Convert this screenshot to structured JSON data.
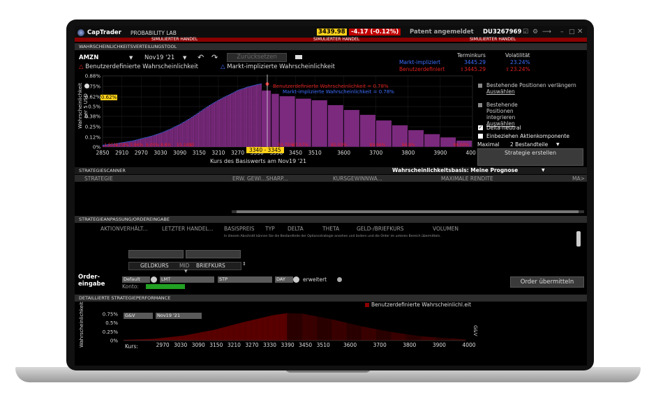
{
  "app": {
    "logo": "CapTrader",
    "module": "PROBABILITY LAB",
    "price": "3439.98",
    "change": "-4.17 (-0.12%)",
    "patent": "Patent angemeldet",
    "account": "DU3267969",
    "simulated": "SIMULIERTER HANDEL"
  },
  "colors": {
    "accent_yellow": "#ffd21a",
    "red": "#e02020",
    "blue": "#3f6fff",
    "purple": "#7b2a7e",
    "dark_red": "#5a0000"
  },
  "tool": {
    "title": "WAHRSCHEINLICHKEITSVERTEILUNGSTOOL",
    "symbol": "AMZN",
    "expiry": "Nov19 '21",
    "reset": "Zurücksetzen",
    "legend_custom": "Benutzerdefinierte Wahrscheinlichkeit",
    "legend_market": "Markt-implizierte Wahrscheinlichkeit",
    "th_terminkurs": "Terminkurs",
    "th_volatility": "Volatilität",
    "row_market_label": "Markt-impliziert",
    "row_market_price": "3445.29",
    "row_market_vol": "23.24%",
    "row_custom_label": "Benutzerdefiniert",
    "row_custom_price": "3445.29",
    "row_custom_vol": "23.24%",
    "opt_extend": "Bestehende Positionen verlängern",
    "opt_extend_link": "Auswählen",
    "opt_integrate": "Bestehende Positionen integrieren",
    "opt_integrate_link": "Auswählen",
    "delta_neutral": "Delta-neutral",
    "include_stock": "Einbeziehen Aktienkomponente",
    "max_label": "Maximal",
    "max_value": "2 Bestandteile",
    "create_strategy": "Strategie erstellen"
  },
  "chart_data": [
    {
      "type": "bar",
      "ylabel": "Wahrscheinlichkeit per 5 USD",
      "xlabel": "Kurs des Basiswerts am Nov19 '21",
      "y_ticks": [
        "0.88%",
        "0.75%",
        "0.62%",
        "0.5%",
        "0.38%",
        "0.25%",
        "0.12%",
        "0%"
      ],
      "x_ticks": [
        "2850",
        "2910",
        "2970",
        "3030",
        "3090",
        "3150",
        "3210",
        "3270",
        "3330",
        "3390",
        "3450",
        "3510",
        "3600",
        "3700",
        "3800",
        "3900",
        "4000"
      ],
      "cumulative_labels": [
        "1.95%",
        "2.72%",
        "3.96%",
        "6.05%",
        "8.8%",
        "13.24%",
        "20",
        "54.75%",
        "67.57%",
        "81.03%",
        "89.96%",
        "94.9%",
        "98.00%"
      ],
      "highlight_range": "3340 - 3345",
      "highlight_y": "0.62%",
      "annotation_custom": "Benutzerdefinierte Wahrscheinlichkeit = 0.78%",
      "annotation_market": "Markt-implizierte Wahrscheinlichkeit = 0.78%",
      "series": [
        {
          "name": "Benutzerdefinierte Wahrscheinlichkeit",
          "x": [
            2850,
            2880,
            2910,
            2940,
            2970,
            3000,
            3030,
            3060,
            3090,
            3120,
            3150,
            3180,
            3210,
            3240,
            3270,
            3300,
            3330,
            3343
          ],
          "values": [
            0.02,
            0.03,
            0.05,
            0.07,
            0.1,
            0.13,
            0.17,
            0.22,
            0.28,
            0.35,
            0.43,
            0.51,
            0.58,
            0.64,
            0.7,
            0.74,
            0.77,
            0.78
          ]
        },
        {
          "name": "Markt-implizierte Wahrscheinlichkeit",
          "x": [
            3343,
            3375,
            3400,
            3450,
            3500,
            3550,
            3600,
            3650,
            3700,
            3750,
            3800,
            3850,
            3900,
            3950,
            4000
          ],
          "values": [
            0.7,
            0.66,
            0.63,
            0.6,
            0.58,
            0.52,
            0.46,
            0.4,
            0.33,
            0.27,
            0.21,
            0.16,
            0.12,
            0.08,
            0.05
          ]
        }
      ]
    },
    {
      "type": "area",
      "ylabel": "Wahrscheinlichkeit",
      "legend": "Benutzerdefinierte Wahrscheinlichl.eit",
      "x_prefix": "Kurs:",
      "y_ticks": [
        "0.75%",
        "0.5%",
        "0.25%",
        "0%"
      ],
      "x_ticks": [
        "2970",
        "3030",
        "3090",
        "3150",
        "3210",
        "3270",
        "3330",
        "3390",
        "3450",
        "3510",
        "3600",
        "3700",
        "3800",
        "3900",
        "4000"
      ],
      "series": [
        {
          "name": "Benutzerdefinierte Wahrscheinlichl.eit",
          "x": [
            2850,
            2950,
            3050,
            3150,
            3250,
            3350,
            3400,
            3450,
            3550,
            3650,
            3750,
            3850,
            3950,
            4000
          ],
          "values": [
            0.02,
            0.05,
            0.14,
            0.3,
            0.52,
            0.72,
            0.78,
            0.76,
            0.6,
            0.4,
            0.24,
            0.12,
            0.06,
            0.03
          ]
        }
      ]
    }
  ],
  "scanner": {
    "title": "STRATEGIESCANNER",
    "basis": "Wahrscheinlichkeitsbasis: Meine Prognose",
    "cols": [
      "STRATEGIE",
      "ERW. GEWI...SHARP...",
      "KURSGEWINNWA...",
      "MAXIMALE RENDITE",
      "MA>"
    ]
  },
  "order": {
    "title": "STRATEGIEANPASSUNG/ORDEREINGABE",
    "cols": [
      "AKTIONVERHÄLT...",
      "LETZTER HANDEL...",
      "BASISPREIS",
      "TYP",
      "DELTA",
      "THETA",
      "GELD-/BRIEFKURS",
      "VOLUMEN"
    ],
    "hint": "In diesem Abschnitt können Sie die Bestandteile der Optionsstrategie ansehen und ändern und die Order im unteren Bereich übermitteln.",
    "bid": "GELDKURS",
    "mid": "MID",
    "ask": "BRIEFKURS",
    "order_label": "Order-eingabe",
    "default": "Default",
    "lmt": "LMT",
    "stp": "STP",
    "day": "DAY",
    "extended": "erweitert",
    "account": "Konto:",
    "submit": "Order übermitteln"
  },
  "perf": {
    "title": "DETAILLIERTE STRATEGIEPERFORMANCE",
    "gv": "G&V",
    "expiry": "Nov19 '21",
    "side_label": "G&V"
  }
}
